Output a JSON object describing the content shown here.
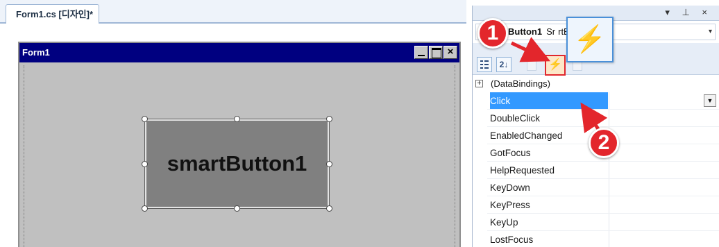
{
  "designer": {
    "tab_label": "Form1.cs [디자인]*",
    "form": {
      "title": "Form1",
      "minimize_glyph": "",
      "close_glyph": "×"
    },
    "button_text": "smartButton1"
  },
  "properties": {
    "header_controls": "▾ ⊥ ×",
    "object_name": "Button1",
    "object_type_prefix": "Sr",
    "object_type_suffix": "rtButton",
    "combo_arrow": "▾",
    "toolbar": {
      "categorized_icon": "categorized-icon",
      "alphabetical_icon": "alphabetical-icon",
      "alphabetical_glyph": "2↓",
      "events_icon": "lightning-icon",
      "events_glyph": "⚡"
    },
    "group": {
      "expand_glyph": "+",
      "label": "(DataBindings)"
    },
    "events": [
      {
        "name": "Click",
        "selected": true
      },
      {
        "name": "DoubleClick",
        "selected": false
      },
      {
        "name": "EnabledChanged",
        "selected": false
      },
      {
        "name": "GotFocus",
        "selected": false
      },
      {
        "name": "HelpRequested",
        "selected": false
      },
      {
        "name": "KeyDown",
        "selected": false
      },
      {
        "name": "KeyPress",
        "selected": false
      },
      {
        "name": "KeyUp",
        "selected": false
      },
      {
        "name": "LostFocus",
        "selected": false
      }
    ],
    "dropdown_glyph": "▼"
  },
  "callouts": {
    "step1": "1",
    "step2": "2",
    "zoom_glyph": "⚡"
  },
  "colors": {
    "form_title_bar": "#000080",
    "selection": "#3399ff",
    "highlight_red": "#e3262c"
  }
}
